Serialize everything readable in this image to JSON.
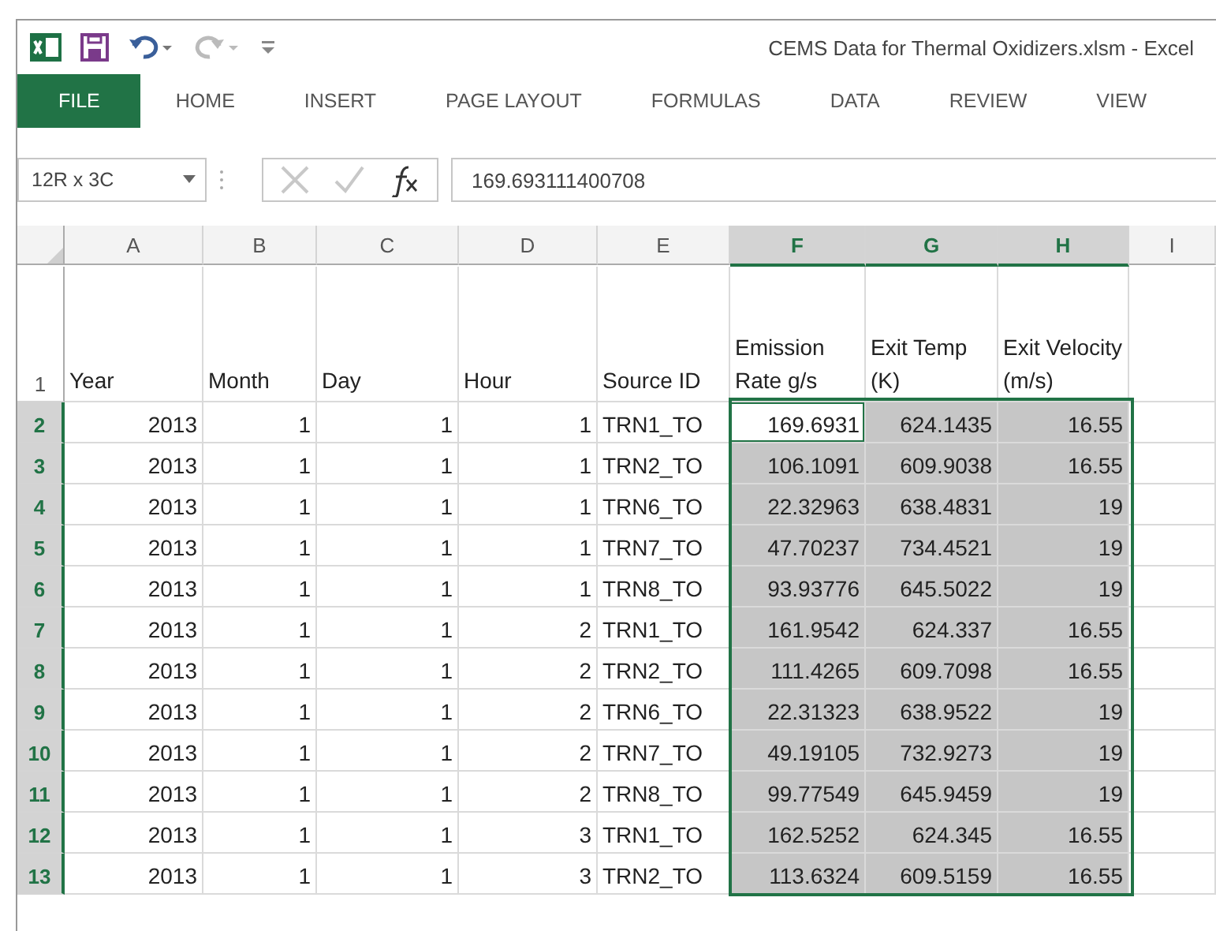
{
  "title_bar": {
    "title": "CEMS Data for Thermal Oxidizers.xlsm - Excel"
  },
  "ribbon_tabs": [
    {
      "label": "FILE",
      "selected": true
    },
    {
      "label": "HOME",
      "selected": false
    },
    {
      "label": "INSERT",
      "selected": false
    },
    {
      "label": "PAGE LAYOUT",
      "selected": false
    },
    {
      "label": "FORMULAS",
      "selected": false
    },
    {
      "label": "DATA",
      "selected": false
    },
    {
      "label": "REVIEW",
      "selected": false
    },
    {
      "label": "VIEW",
      "selected": false
    }
  ],
  "name_box": {
    "value": "12R x 3C"
  },
  "formula_bar": {
    "value": "169.693111400708"
  },
  "columns": [
    {
      "label": "A",
      "selected": false,
      "active": false,
      "kind": "number"
    },
    {
      "label": "B",
      "selected": false,
      "active": false,
      "kind": "number"
    },
    {
      "label": "C",
      "selected": false,
      "active": false,
      "kind": "number"
    },
    {
      "label": "D",
      "selected": false,
      "active": false,
      "kind": "number"
    },
    {
      "label": "E",
      "selected": false,
      "active": false,
      "kind": "text"
    },
    {
      "label": "F",
      "selected": true,
      "active": true,
      "kind": "number"
    },
    {
      "label": "G",
      "selected": true,
      "active": false,
      "kind": "number"
    },
    {
      "label": "H",
      "selected": true,
      "active": false,
      "kind": "number"
    },
    {
      "label": "I",
      "selected": false,
      "active": false,
      "kind": "number"
    }
  ],
  "header_row": {
    "number": "1",
    "cells": [
      "Year",
      "Month",
      "Day",
      "Hour",
      "Source ID",
      "Emission Rate g/s",
      "Exit Temp (K)",
      "Exit Velocity (m/s)"
    ]
  },
  "rows": [
    {
      "number": "2",
      "selected": true,
      "active": true,
      "cells": [
        "2013",
        "1",
        "1",
        "1",
        "TRN1_TO",
        "169.6931",
        "624.1435",
        "16.55"
      ]
    },
    {
      "number": "3",
      "selected": true,
      "active": false,
      "cells": [
        "2013",
        "1",
        "1",
        "1",
        "TRN2_TO",
        "106.1091",
        "609.9038",
        "16.55"
      ]
    },
    {
      "number": "4",
      "selected": true,
      "active": false,
      "cells": [
        "2013",
        "1",
        "1",
        "1",
        "TRN6_TO",
        "22.32963",
        "638.4831",
        "19"
      ]
    },
    {
      "number": "5",
      "selected": true,
      "active": false,
      "cells": [
        "2013",
        "1",
        "1",
        "1",
        "TRN7_TO",
        "47.70237",
        "734.4521",
        "19"
      ]
    },
    {
      "number": "6",
      "selected": true,
      "active": false,
      "cells": [
        "2013",
        "1",
        "1",
        "1",
        "TRN8_TO",
        "93.93776",
        "645.5022",
        "19"
      ]
    },
    {
      "number": "7",
      "selected": true,
      "active": false,
      "cells": [
        "2013",
        "1",
        "1",
        "2",
        "TRN1_TO",
        "161.9542",
        "624.337",
        "16.55"
      ]
    },
    {
      "number": "8",
      "selected": true,
      "active": false,
      "cells": [
        "2013",
        "1",
        "1",
        "2",
        "TRN2_TO",
        "111.4265",
        "609.7098",
        "16.55"
      ]
    },
    {
      "number": "9",
      "selected": true,
      "active": false,
      "cells": [
        "2013",
        "1",
        "1",
        "2",
        "TRN6_TO",
        "22.31323",
        "638.9522",
        "19"
      ]
    },
    {
      "number": "10",
      "selected": true,
      "active": false,
      "cells": [
        "2013",
        "1",
        "1",
        "2",
        "TRN7_TO",
        "49.19105",
        "732.9273",
        "19"
      ]
    },
    {
      "number": "11",
      "selected": true,
      "active": false,
      "cells": [
        "2013",
        "1",
        "1",
        "2",
        "TRN8_TO",
        "99.77549",
        "645.9459",
        "19"
      ]
    },
    {
      "number": "12",
      "selected": true,
      "active": false,
      "cells": [
        "2013",
        "1",
        "1",
        "3",
        "TRN1_TO",
        "162.5252",
        "624.345",
        "16.55"
      ]
    },
    {
      "number": "13",
      "selected": true,
      "active": false,
      "cells": [
        "2013",
        "1",
        "1",
        "3",
        "TRN2_TO",
        "113.6324",
        "609.5159",
        "16.55"
      ]
    }
  ]
}
